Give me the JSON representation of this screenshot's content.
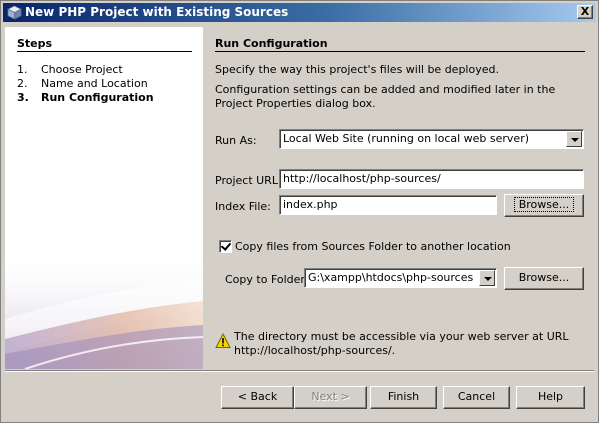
{
  "window": {
    "title": "New PHP Project with Existing Sources",
    "close_label": "X"
  },
  "steps": {
    "header": "Steps",
    "items": [
      {
        "num": "1.",
        "label": "Choose Project"
      },
      {
        "num": "2.",
        "label": "Name and Location"
      },
      {
        "num": "3.",
        "label": "Run Configuration"
      }
    ],
    "current_index": 2
  },
  "panel": {
    "title": "Run Configuration",
    "description": "Specify the way this project's files will be deployed.",
    "note": "Configuration settings can be added and modified later in the Project Properties dialog box."
  },
  "form": {
    "run_as_label": "Run As:",
    "run_as_value": "Local Web Site (running on local web server)",
    "project_url_label": "Project URL:",
    "project_url_value": "http://localhost/php-sources/",
    "index_file_label": "Index File:",
    "index_file_value": "index.php",
    "browse_label": "Browse...",
    "copy_checkbox_label": "Copy files from Sources Folder to another location",
    "copy_checkbox_checked": true,
    "copy_to_label": "Copy to Folder:",
    "copy_to_value": "G:\\xampp\\htdocs\\php-sources",
    "browse2_label": "Browse..."
  },
  "warning": {
    "icon": "warning-icon",
    "text": "The directory must be accessible via your web server at URL http://localhost/php-sources/."
  },
  "buttons": {
    "back": "< Back",
    "next": "Next >",
    "finish": "Finish",
    "cancel": "Cancel",
    "help": "Help"
  }
}
